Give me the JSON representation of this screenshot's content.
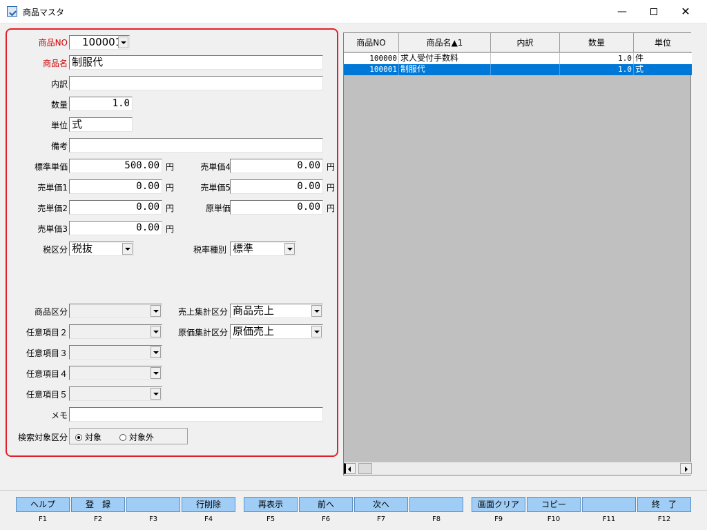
{
  "window": {
    "title": "商品マスタ",
    "minimize": "—",
    "close": "✕"
  },
  "form": {
    "product_no": {
      "label": "商品NO",
      "value": "100001"
    },
    "product_name": {
      "label": "商品名",
      "value": "制服代"
    },
    "breakdown": {
      "label": "内訳",
      "value": ""
    },
    "quantity": {
      "label": "数量",
      "value": "1.0"
    },
    "unit": {
      "label": "単位",
      "value": "式"
    },
    "remarks": {
      "label": "備考",
      "value": ""
    },
    "standard_price": {
      "label": "標準単価",
      "value": "500.00",
      "unit": "円"
    },
    "price1": {
      "label": "売単価1",
      "value": "0.00",
      "unit": "円"
    },
    "price2": {
      "label": "売単価2",
      "value": "0.00",
      "unit": "円"
    },
    "price3": {
      "label": "売単価3",
      "value": "0.00",
      "unit": "円"
    },
    "price4": {
      "label": "売単価4",
      "value": "0.00",
      "unit": "円"
    },
    "price5": {
      "label": "売単価5",
      "value": "0.00",
      "unit": "円"
    },
    "cost_price": {
      "label": "原単価",
      "value": "0.00",
      "unit": "円"
    },
    "tax_class": {
      "label": "税区分",
      "value": "税抜"
    },
    "tax_rate_type": {
      "label": "税率種別",
      "value": "標準"
    },
    "product_class": {
      "label": "商品区分",
      "value": ""
    },
    "sales_class": {
      "label": "売上集計区分",
      "value": "商品売上"
    },
    "optional2": {
      "label": "任意項目２",
      "value": ""
    },
    "cost_class": {
      "label": "原価集計区分",
      "value": "原価売上"
    },
    "optional3": {
      "label": "任意項目３",
      "value": ""
    },
    "optional4": {
      "label": "任意項目４",
      "value": ""
    },
    "optional5": {
      "label": "任意項目５",
      "value": ""
    },
    "memo": {
      "label": "メモ",
      "value": ""
    },
    "search_target": {
      "label": "検索対象区分",
      "options": [
        "対象",
        "対象外"
      ],
      "selected": "対象"
    }
  },
  "grid": {
    "columns": [
      "商品NO",
      "商品名▲1",
      "内訳",
      "数量",
      "単位"
    ],
    "rows": [
      {
        "no": "100000",
        "name": "求人受付手数料",
        "breakdown": "",
        "qty": "1.0",
        "unit": "件",
        "selected": false
      },
      {
        "no": "100001",
        "name": "制服代",
        "breakdown": "",
        "qty": "1.0",
        "unit": "式",
        "selected": true
      }
    ]
  },
  "fkeys": [
    {
      "key": "F1",
      "label": "ヘルプ"
    },
    {
      "key": "F2",
      "label": "登　録"
    },
    {
      "key": "F3",
      "label": ""
    },
    {
      "key": "F4",
      "label": "行削除"
    },
    {
      "key": "F5",
      "label": "再表示"
    },
    {
      "key": "F6",
      "label": "前へ"
    },
    {
      "key": "F7",
      "label": "次へ"
    },
    {
      "key": "F8",
      "label": ""
    },
    {
      "key": "F9",
      "label": "画面クリア"
    },
    {
      "key": "F10",
      "label": "コピー"
    },
    {
      "key": "F11",
      "label": ""
    },
    {
      "key": "F12",
      "label": "終　了"
    }
  ]
}
